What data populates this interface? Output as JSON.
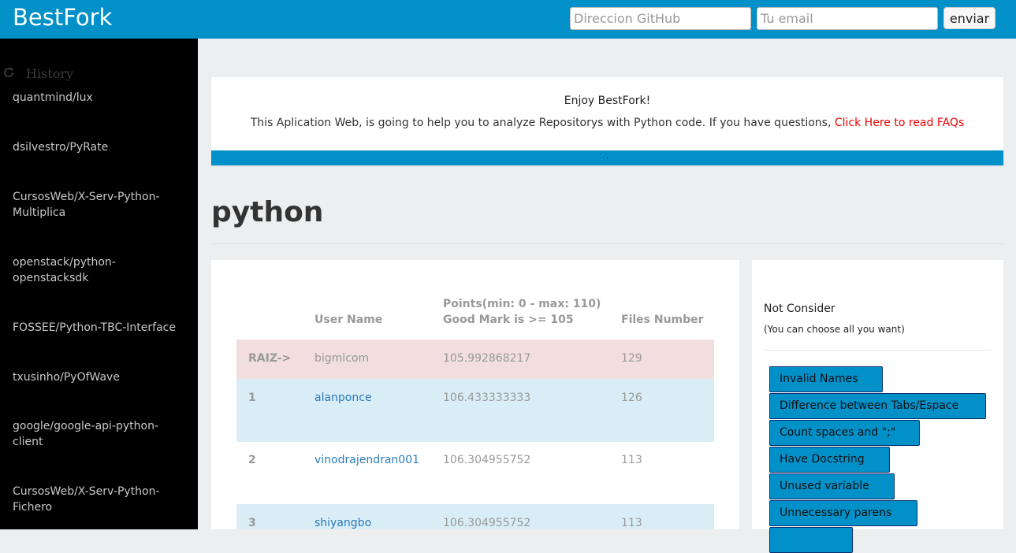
{
  "app": {
    "title": "BestFork"
  },
  "header": {
    "github_placeholder": "Direccion GitHub",
    "email_placeholder": "Tu email",
    "send_label": "enviar"
  },
  "sidebar": {
    "history_label": "History",
    "history_icon": "refresh-icon",
    "items": [
      "quantmind/lux",
      "dsilvestro/PyRate",
      "CursosWeb/X-Serv-Python-Multiplica",
      "openstack/python-openstacksdk",
      "FOSSEE/Python-TBC-Interface",
      "txusinho/PyOfWave",
      "google/google-api-python-client",
      "CursosWeb/X-Serv-Python-Fichero"
    ]
  },
  "notice": {
    "title": "Enjoy BestFork!",
    "text": "This Aplication Web, is going to help you to analyze Repositorys with Python code. If you have questions,",
    "link": "Click Here to read FAQs",
    "bar_text": "."
  },
  "main": {
    "title": "python"
  },
  "table": {
    "headers": {
      "user": "User Name",
      "points_line1": "Points(min: 0 - max: 110)",
      "points_line2": "Good Mark is >= 105",
      "files": "Files Number"
    },
    "rows": [
      {
        "rank": "RAIZ->",
        "user": "bigmlcom",
        "points": "105.992868217",
        "files": "129"
      },
      {
        "rank": "1",
        "user": "alanponce",
        "points": "106.433333333",
        "files": "126"
      },
      {
        "rank": "2",
        "user": "vinodrajendran001",
        "points": "106.304955752",
        "files": "113"
      },
      {
        "rank": "3",
        "user": "shiyangbo",
        "points": "106.304955752",
        "files": "113"
      }
    ]
  },
  "filters": {
    "title": "Not Consider",
    "subtitle": "(You can choose all you want)",
    "options": [
      "Invalid Names",
      "Difference between Tabs/Espace",
      "Count spaces and \";\"",
      "Have Docstring",
      "Unused variable",
      "Unnecessary parens"
    ]
  },
  "colors": {
    "accent": "#0290c9",
    "row_root": "#f2dede",
    "row_highlight": "#d9edf7",
    "link_red": "#ee0000",
    "link_blue": "#2a7ab8"
  }
}
